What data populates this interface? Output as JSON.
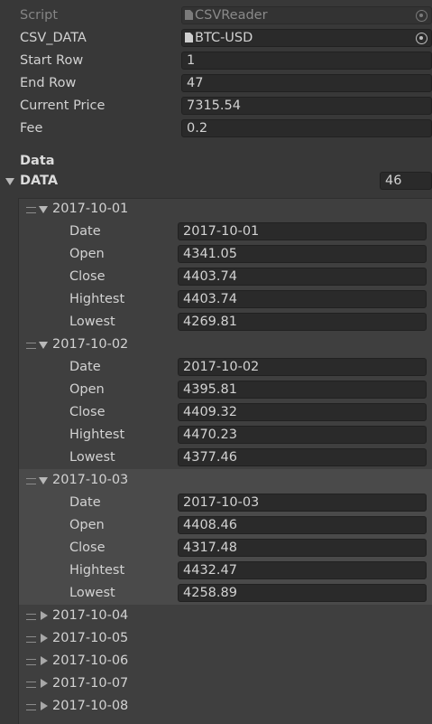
{
  "fields": {
    "script": {
      "label": "Script",
      "value": "CSVReader",
      "icon": "script-file-icon"
    },
    "csv_data": {
      "label": "CSV_DATA",
      "value": "BTC-USD",
      "icon": "text-asset-icon"
    },
    "start_row": {
      "label": "Start Row",
      "value": "1"
    },
    "end_row": {
      "label": "End Row",
      "value": "47"
    },
    "current_price": {
      "label": "Current Price",
      "value": "7315.54"
    },
    "fee": {
      "label": "Fee",
      "value": "0.2"
    }
  },
  "data_header": "Data",
  "data_list": {
    "label": "DATA",
    "size": "46"
  },
  "field_labels": {
    "date": "Date",
    "open": "Open",
    "close": "Close",
    "high": "Hightest",
    "low": "Lowest"
  },
  "elements": [
    {
      "name": "2017-10-01",
      "date": "2017-10-01",
      "open": "4341.05",
      "close": "4403.74",
      "high": "4403.74",
      "low": "4269.81"
    },
    {
      "name": "2017-10-02",
      "date": "2017-10-02",
      "open": "4395.81",
      "close": "4409.32",
      "high": "4470.23",
      "low": "4377.46"
    },
    {
      "name": "2017-10-03",
      "date": "2017-10-03",
      "open": "4408.46",
      "close": "4317.48",
      "high": "4432.47",
      "low": "4258.89"
    }
  ],
  "collapsed": [
    "2017-10-04",
    "2017-10-05",
    "2017-10-06",
    "2017-10-07",
    "2017-10-08"
  ],
  "colors": {
    "background": "#383838",
    "field": "#2a2a2a",
    "list": "#3f3f3f",
    "selected": "#4a4a4a"
  }
}
